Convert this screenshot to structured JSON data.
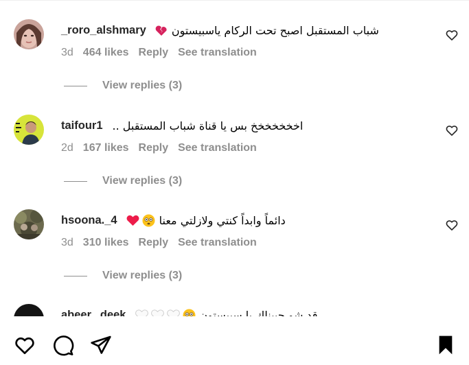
{
  "comments": [
    {
      "username": "_roro_alshmary",
      "text": "شباب المستقبل اصبح تحت الركام ياسبيستون",
      "emojis": [
        "broken-heart-emoji"
      ],
      "time": "3d",
      "likes": "464 likes",
      "reply_label": "Reply",
      "translate_label": "See translation",
      "view_replies": "View replies (3)"
    },
    {
      "username": "taifour1",
      "text": "اخخخخخخخ بس يا قناة شباب المستقبل ..",
      "emojis": [],
      "time": "2d",
      "likes": "167 likes",
      "reply_label": "Reply",
      "translate_label": "See translation",
      "view_replies": "View replies (3)"
    },
    {
      "username": "hsoona._4",
      "text": "دائماً وابداً كنتي ولازلتي معنا",
      "emojis": [
        "red-heart-emoji",
        "flushed-face-emoji"
      ],
      "time": "3d",
      "likes": "310 likes",
      "reply_label": "Reply",
      "translate_label": "See translation",
      "view_replies": "View replies (3)"
    },
    {
      "username": "abeer._deek",
      "text": "قد شو حبيناك يا سبيستون",
      "emojis": [
        "white-heart-emoji",
        "white-heart-emoji",
        "white-heart-emoji",
        "flushed-face-emoji"
      ]
    }
  ],
  "bottom_bar": {
    "icons": [
      "heart-icon",
      "comment-icon",
      "share-icon",
      "bookmark-icon"
    ]
  },
  "colors": {
    "muted_text": "#8e8e8e",
    "username": "#262626",
    "red_heart": "#ed1c4a",
    "broken_heart": "#d6225d",
    "emoji_yellow": "#fcc21b"
  }
}
